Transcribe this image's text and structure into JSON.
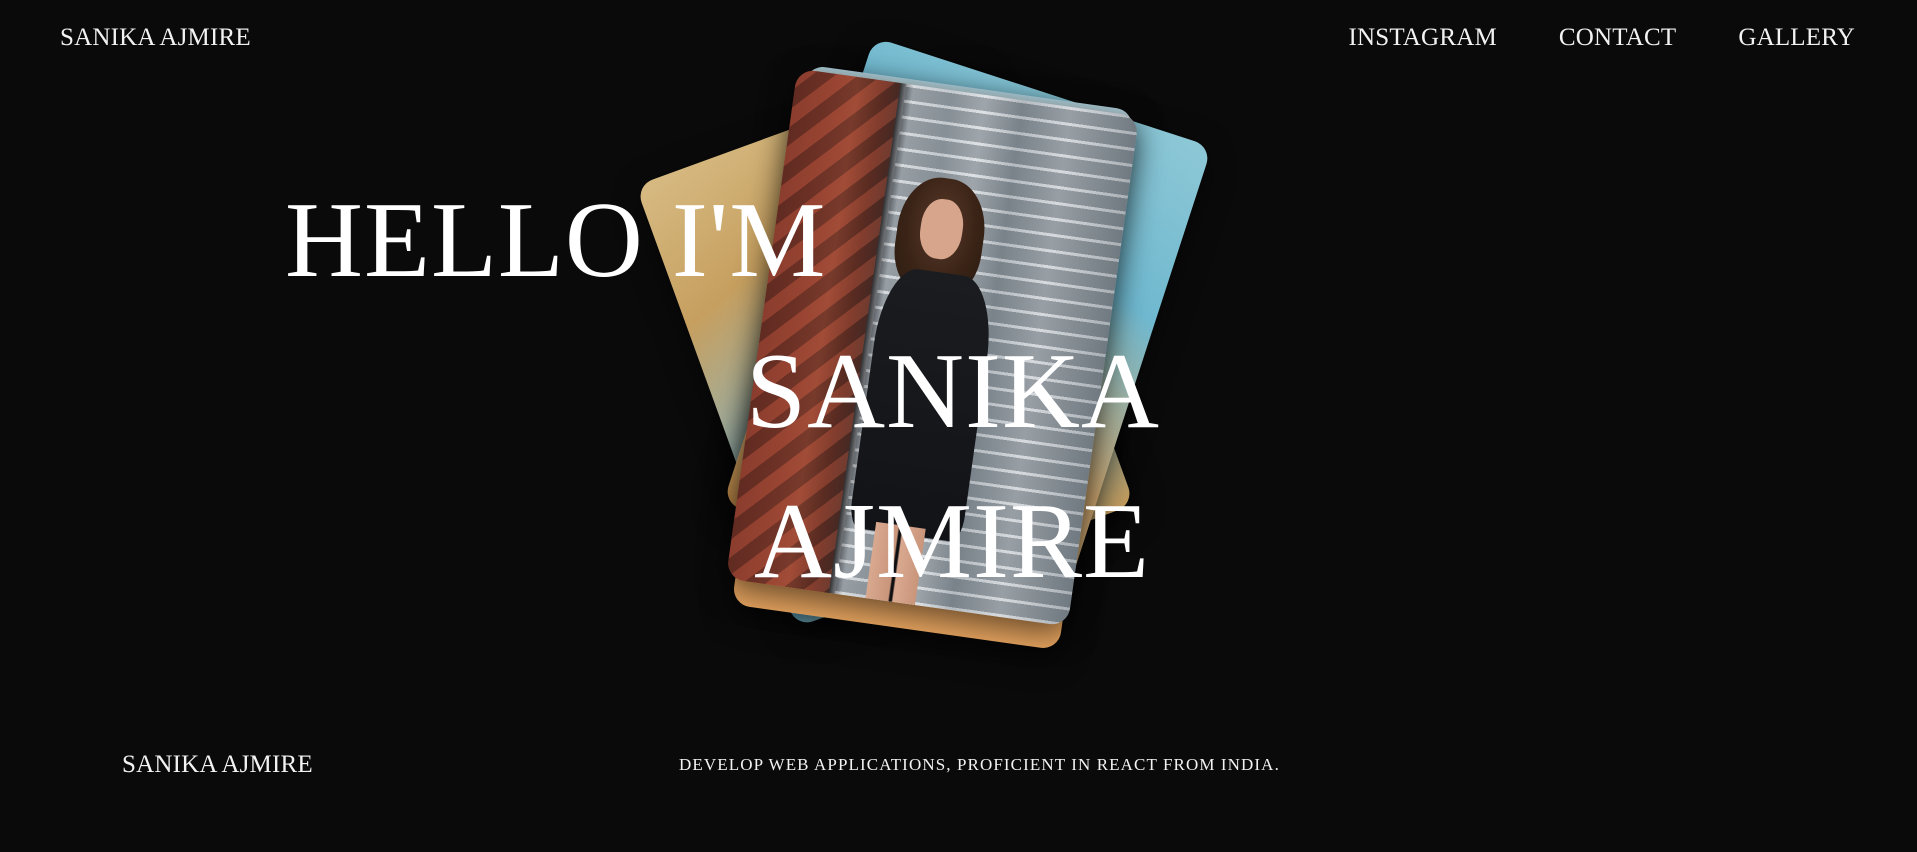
{
  "header": {
    "brand": "SANIKA AJMIRE",
    "nav": [
      {
        "label": "INSTAGRAM"
      },
      {
        "label": "CONTACT"
      },
      {
        "label": "GALLERY"
      }
    ]
  },
  "hero": {
    "line1": "HELLO I'M",
    "line2": "SANIKA",
    "line3": "AJMIRE"
  },
  "footer": {
    "name": "SANIKA AJMIRE",
    "tagline": "DEVELOP WEB APPLICATIONS, PROFICIENT IN REACT FROM INDIA."
  }
}
